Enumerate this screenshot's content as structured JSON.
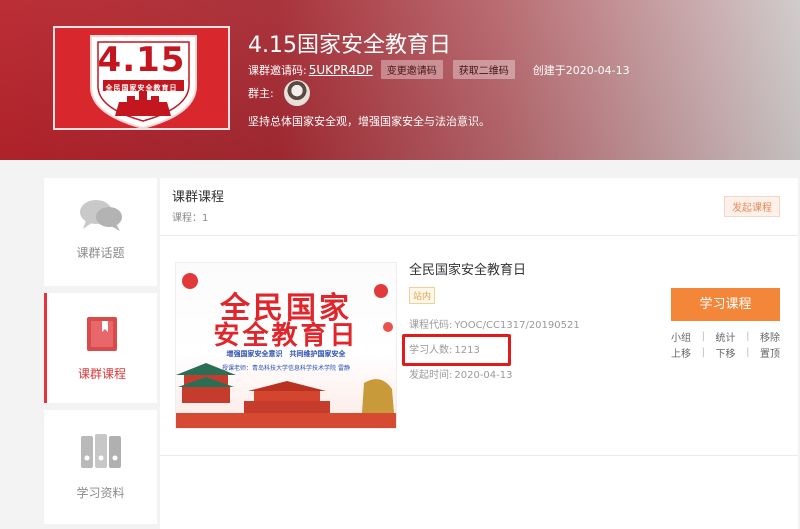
{
  "group": {
    "title": "4.15国家安全教育日",
    "invite_label": "课群邀请码:",
    "invite_code": "5UKPR4DP",
    "change_code_label": "变更邀请码",
    "get_qr_label": "获取二维码",
    "created_label": "创建于2020-04-13",
    "owner_label": "群主:",
    "description": "坚持总体国家安全观，增强国家安全与法治意识。",
    "logo": {
      "number": "4.15",
      "subtitle": "全民国家安全教育日"
    }
  },
  "sidebar": {
    "items": [
      {
        "label": "课群话题",
        "icon": "chat-bubbles-icon",
        "active": false
      },
      {
        "label": "课群课程",
        "icon": "book-icon",
        "active": true
      },
      {
        "label": "学习资料",
        "icon": "binders-icon",
        "active": false
      }
    ]
  },
  "panel": {
    "title": "课群课程",
    "count_text": "课程：1",
    "launch_label": "发起课程"
  },
  "course": {
    "title": "全民国家安全教育日",
    "tag": "站内",
    "code_label": "课程代码:",
    "code_value": "YOOC/CC1317/20190521",
    "students_label": "学习人数:",
    "students_value": "1213",
    "date_label": "发起时间:",
    "date_value": "2020-04-13",
    "cover": {
      "line1": "全民国家",
      "line2": "安全教育日",
      "slogan": "增强国家安全意识　共同维护国家安全",
      "teacher": "授课老师：青岛科技大学信息科学技术学院 雷静"
    },
    "study_button": "学习课程",
    "actions": [
      "小组",
      "统计",
      "移除",
      "上移",
      "下移",
      "置顶"
    ]
  },
  "colors": {
    "brand_red": "#d8272d",
    "active_red": "#e6343c",
    "orange": "#f4863a",
    "highlight_red": "#e21a1a"
  }
}
